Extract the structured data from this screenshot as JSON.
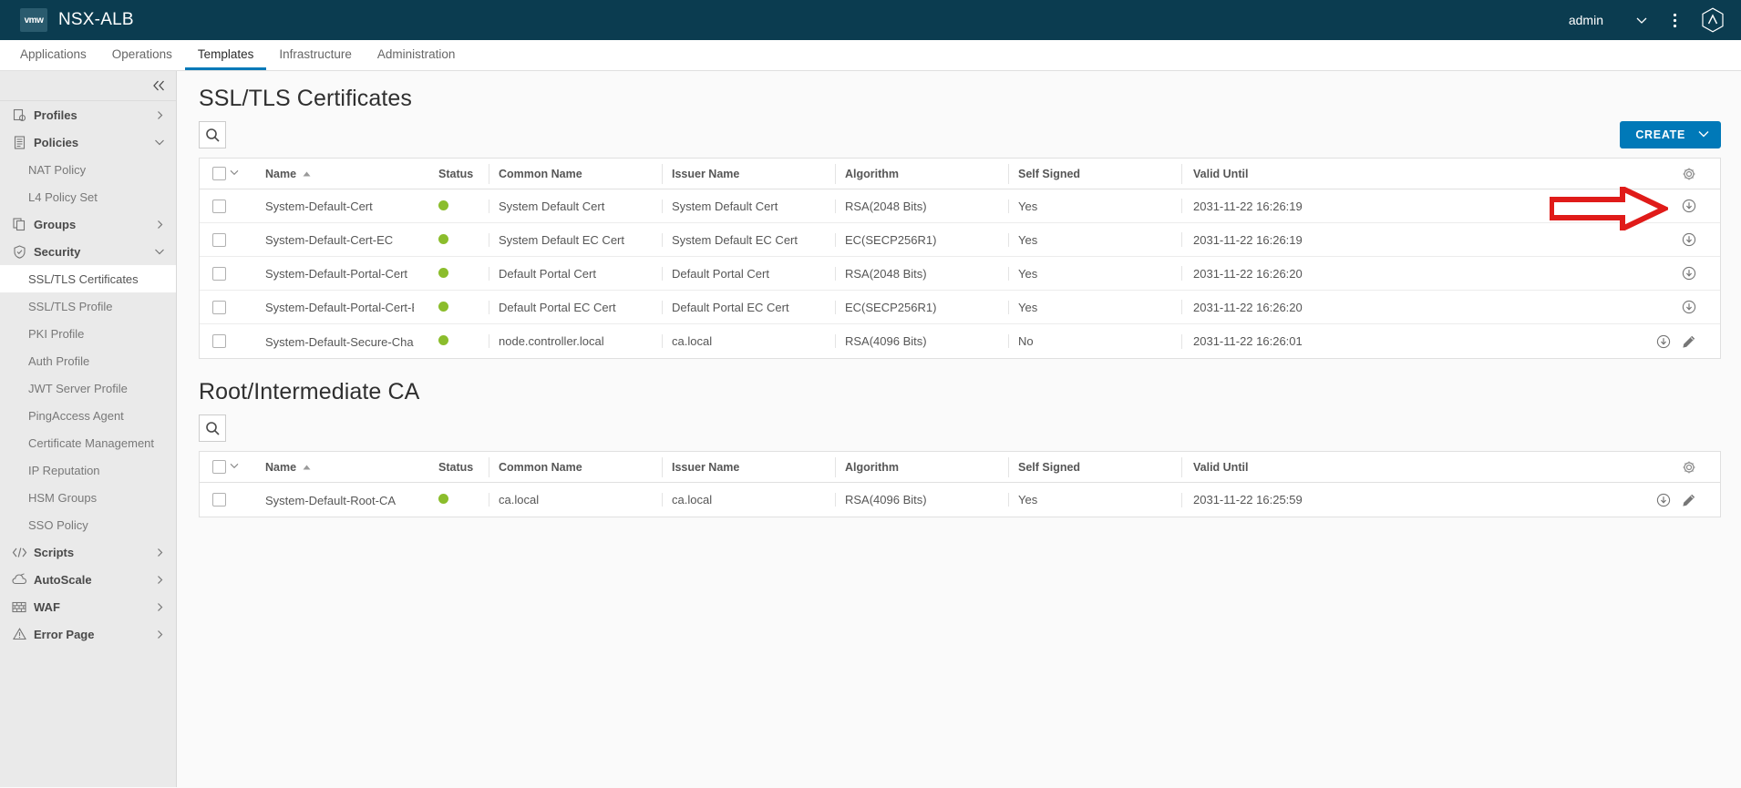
{
  "header": {
    "logo_text": "vmw",
    "app_title": "NSX-ALB",
    "user": "admin",
    "user_caret_icon": "chevron-down-icon",
    "overflow_icon": "vertical-dots-icon",
    "brand_icon": "avi-hexagon-logo-icon"
  },
  "nav": {
    "items": [
      {
        "label": "Applications",
        "active": false
      },
      {
        "label": "Operations",
        "active": false
      },
      {
        "label": "Templates",
        "active": true
      },
      {
        "label": "Infrastructure",
        "active": false
      },
      {
        "label": "Administration",
        "active": false
      }
    ]
  },
  "sidebar": {
    "collapse_icon": "double-chevron-left-icon",
    "items": [
      {
        "label": "Profiles",
        "type": "group",
        "icon": "profiles-icon",
        "caret": "chevron-right-icon",
        "expanded": false,
        "active": false
      },
      {
        "label": "Policies",
        "type": "group",
        "icon": "policies-icon",
        "caret": "chevron-down-icon",
        "expanded": true,
        "active": false
      },
      {
        "label": "NAT Policy",
        "type": "leaf",
        "active": false
      },
      {
        "label": "L4 Policy Set",
        "type": "leaf",
        "active": false
      },
      {
        "label": "Groups",
        "type": "group",
        "icon": "groups-icon",
        "caret": "chevron-right-icon",
        "expanded": false,
        "active": false
      },
      {
        "label": "Security",
        "type": "group",
        "icon": "shield-icon",
        "caret": "chevron-down-icon",
        "expanded": true,
        "active": false
      },
      {
        "label": "SSL/TLS Certificates",
        "type": "leaf",
        "active": true
      },
      {
        "label": "SSL/TLS Profile",
        "type": "leaf",
        "active": false
      },
      {
        "label": "PKI Profile",
        "type": "leaf",
        "active": false
      },
      {
        "label": "Auth Profile",
        "type": "leaf",
        "active": false
      },
      {
        "label": "JWT Server Profile",
        "type": "leaf",
        "active": false
      },
      {
        "label": "PingAccess Agent",
        "type": "leaf",
        "active": false
      },
      {
        "label": "Certificate Management",
        "type": "leaf",
        "active": false
      },
      {
        "label": "IP Reputation",
        "type": "leaf",
        "active": false
      },
      {
        "label": "HSM Groups",
        "type": "leaf",
        "active": false
      },
      {
        "label": "SSO Policy",
        "type": "leaf",
        "active": false
      },
      {
        "label": "Scripts",
        "type": "group",
        "icon": "code-icon",
        "caret": "chevron-right-icon",
        "expanded": false,
        "active": false
      },
      {
        "label": "AutoScale",
        "type": "group",
        "icon": "cloud-scale-icon",
        "caret": "chevron-right-icon",
        "expanded": false,
        "active": false
      },
      {
        "label": "WAF",
        "type": "group",
        "icon": "firewall-icon",
        "caret": "chevron-right-icon",
        "expanded": false,
        "active": false
      },
      {
        "label": "Error Page",
        "type": "group",
        "icon": "warning-triangle-icon",
        "caret": "chevron-right-icon",
        "expanded": false,
        "active": false
      }
    ]
  },
  "certificates_section": {
    "title": "SSL/TLS Certificates",
    "search_icon": "search-icon",
    "create_label": "CREATE",
    "create_caret_icon": "chevron-down-icon",
    "settings_icon": "gear-icon",
    "columns": [
      "Name",
      "Status",
      "Common Name",
      "Issuer Name",
      "Algorithm",
      "Self Signed",
      "Valid Until"
    ],
    "sort_column": "Name",
    "sort_direction": "asc",
    "rows": [
      {
        "name": "System-Default-Cert",
        "status": "green",
        "common_name": "System Default Cert",
        "issuer_name": "System Default Cert",
        "algorithm": "RSA(2048 Bits)",
        "self_signed": "Yes",
        "valid_until": "2031-11-22 16:26:19",
        "actions": [
          "download-icon"
        ]
      },
      {
        "name": "System-Default-Cert-EC",
        "status": "green",
        "common_name": "System Default EC Cert",
        "issuer_name": "System Default EC Cert",
        "algorithm": "EC(SECP256R1)",
        "self_signed": "Yes",
        "valid_until": "2031-11-22 16:26:19",
        "actions": [
          "download-icon"
        ]
      },
      {
        "name": "System-Default-Portal-Cert",
        "status": "green",
        "common_name": "Default Portal Cert",
        "issuer_name": "Default Portal Cert",
        "algorithm": "RSA(2048 Bits)",
        "self_signed": "Yes",
        "valid_until": "2031-11-22 16:26:20",
        "actions": [
          "download-icon"
        ]
      },
      {
        "name": "System-Default-Portal-Cert-EC",
        "status": "green",
        "common_name": "Default Portal EC Cert",
        "issuer_name": "Default Portal EC Cert",
        "algorithm": "EC(SECP256R1)",
        "self_signed": "Yes",
        "valid_until": "2031-11-22 16:26:20",
        "actions": [
          "download-icon"
        ]
      },
      {
        "name": "System-Default-Secure-Channel-Cert",
        "status": "green",
        "common_name": "node.controller.local",
        "issuer_name": "ca.local",
        "algorithm": "RSA(4096 Bits)",
        "self_signed": "No",
        "valid_until": "2031-11-22 16:26:01",
        "actions": [
          "download-icon",
          "edit-icon"
        ]
      }
    ]
  },
  "root_ca_section": {
    "title": "Root/Intermediate CA",
    "search_icon": "search-icon",
    "settings_icon": "gear-icon",
    "columns": [
      "Name",
      "Status",
      "Common Name",
      "Issuer Name",
      "Algorithm",
      "Self Signed",
      "Valid Until"
    ],
    "sort_column": "Name",
    "sort_direction": "asc",
    "rows": [
      {
        "name": "System-Default-Root-CA",
        "status": "green",
        "common_name": "ca.local",
        "issuer_name": "ca.local",
        "algorithm": "RSA(4096 Bits)",
        "self_signed": "Yes",
        "valid_until": "2031-11-22 16:25:59",
        "actions": [
          "download-icon",
          "edit-icon"
        ]
      }
    ]
  },
  "annotation": {
    "type": "red-arrow",
    "points_at": "download-icon-row-1",
    "color": "#e01b19"
  },
  "colors": {
    "header_bg": "#0b3c50",
    "accent": "#0079b8",
    "status_green": "#8bbd2c",
    "sidebar_bg": "#eaeaea"
  }
}
